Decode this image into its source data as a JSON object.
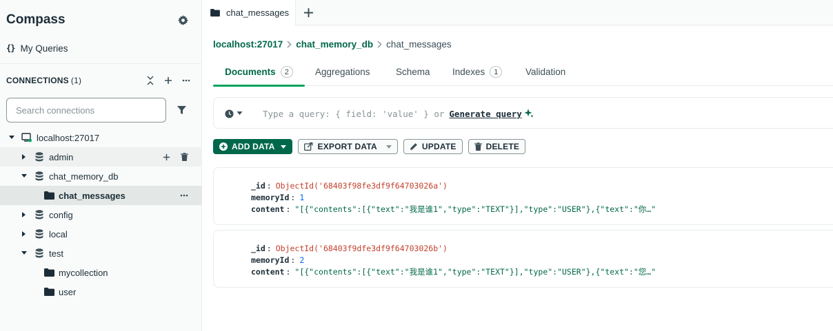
{
  "sidebar": {
    "app_title": "Compass",
    "my_queries_icon": "{}",
    "my_queries_label": "My Queries",
    "connections_label": "CONNECTIONS",
    "connections_count": "(1)",
    "search_placeholder": "Search connections",
    "tree": {
      "connection": "localhost:27017",
      "databases": [
        {
          "name": "admin",
          "expanded": false
        },
        {
          "name": "chat_memory_db",
          "expanded": true,
          "collections": [
            "chat_messages"
          ]
        },
        {
          "name": "config",
          "expanded": false
        },
        {
          "name": "local",
          "expanded": false
        },
        {
          "name": "test",
          "expanded": true,
          "collections": [
            "mycollection",
            "user"
          ]
        }
      ]
    }
  },
  "tabs": [
    {
      "label": "chat_messages",
      "icon": "folder-icon",
      "active": true
    }
  ],
  "breadcrumb": {
    "connection": "localhost:27017",
    "database": "chat_memory_db",
    "collection": "chat_messages"
  },
  "subtabs": [
    {
      "label": "Documents",
      "badge": "2",
      "active": true
    },
    {
      "label": "Aggregations"
    },
    {
      "label": "Schema"
    },
    {
      "label": "Indexes",
      "badge": "1"
    },
    {
      "label": "Validation"
    }
  ],
  "query": {
    "placeholder": "Type a query: { field: 'value' } or",
    "generate_label": "Generate query"
  },
  "toolbar": {
    "add_data": "ADD DATA",
    "export_data": "EXPORT DATA",
    "update": "UPDATE",
    "delete": "DELETE"
  },
  "documents": [
    {
      "id_key": "_id",
      "id_value": "ObjectId('68403f98fe3df9f64703026a')",
      "memory_key": "memoryId",
      "memory_value": "1",
      "content_key": "content",
      "content_value": "\"[{\"contents\":[{\"text\":\"我是谁1\",\"type\":\"TEXT\"}],\"type\":\"USER\"},{\"text\":\"你…\""
    },
    {
      "id_key": "_id",
      "id_value": "ObjectId('68403f9dfe3df9f64703026b')",
      "memory_key": "memoryId",
      "memory_value": "2",
      "content_key": "content",
      "content_value": "\"[{\"contents\":[{\"text\":\"我是谁1\",\"type\":\"TEXT\"}],\"type\":\"USER\"},{\"text\":\"您…\""
    }
  ],
  "colors": {
    "brand_green": "#00684a",
    "accent_green": "#00a35c",
    "objectid_red": "#c2402b",
    "number_blue": "#016bf8"
  }
}
